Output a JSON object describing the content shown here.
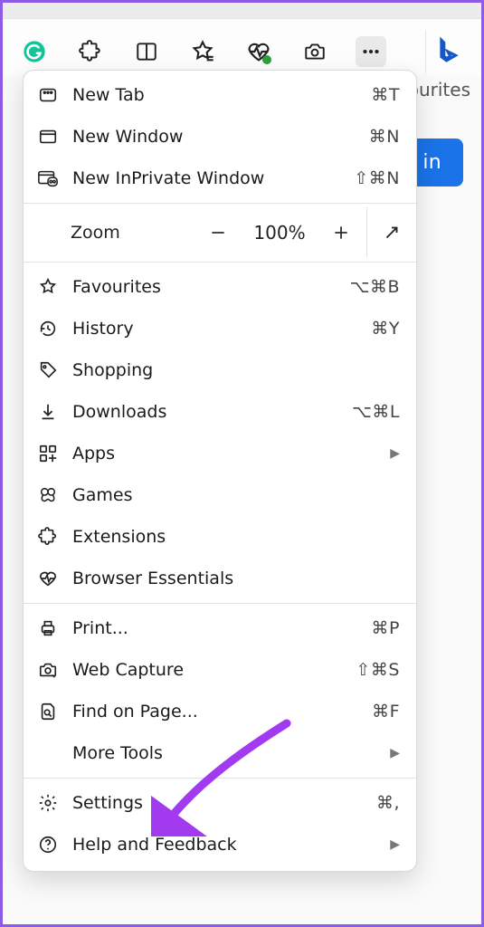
{
  "toolbar": {
    "grammarly_icon": "grammarly",
    "extension_icon": "puzzle",
    "split_icon": "split-screen",
    "fav_icon": "star-lines",
    "health_icon": "heart-pulse",
    "capture_icon": "camera",
    "more_icon": "more",
    "bing_icon": "bing"
  },
  "page": {
    "favourites_peek": "rourites",
    "signin_fragment": "in"
  },
  "menu": {
    "new_tab": {
      "label": "New Tab",
      "shortcut": "⌘T"
    },
    "new_window": {
      "label": "New Window",
      "shortcut": "⌘N"
    },
    "new_inprivate": {
      "label": "New InPrivate Window",
      "shortcut": "⇧⌘N"
    },
    "zoom": {
      "label": "Zoom",
      "pct": "100%"
    },
    "favourites": {
      "label": "Favourites",
      "shortcut": "⌥⌘B"
    },
    "history": {
      "label": "History",
      "shortcut": "⌘Y"
    },
    "shopping": {
      "label": "Shopping"
    },
    "downloads": {
      "label": "Downloads",
      "shortcut": "⌥⌘L"
    },
    "apps": {
      "label": "Apps"
    },
    "games": {
      "label": "Games"
    },
    "extensions": {
      "label": "Extensions"
    },
    "essentials": {
      "label": "Browser Essentials"
    },
    "print": {
      "label": "Print...",
      "shortcut": "⌘P"
    },
    "web_capture": {
      "label": "Web Capture",
      "shortcut": "⇧⌘S"
    },
    "find": {
      "label": "Find on Page...",
      "shortcut": "⌘F"
    },
    "more_tools": {
      "label": "More Tools"
    },
    "settings": {
      "label": "Settings",
      "shortcut": "⌘,"
    },
    "help": {
      "label": "Help and Feedback"
    }
  }
}
